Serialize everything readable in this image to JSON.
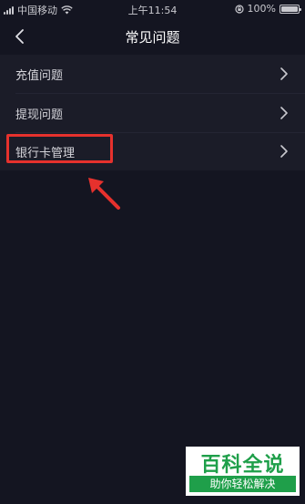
{
  "status_bar": {
    "carrier": "中国移动",
    "time": "上午11:54",
    "battery_percent": "100%",
    "battery_level": 1.0
  },
  "nav": {
    "title": "常见问题"
  },
  "faq_items": [
    {
      "label": "充值问题"
    },
    {
      "label": "提现问题"
    },
    {
      "label": "银行卡管理"
    }
  ],
  "colors": {
    "background": "#141521",
    "list_background": "#1b1c28",
    "highlight": "#e6312d",
    "watermark_green": "#1f9f4a"
  },
  "watermark": {
    "title": "百科全说",
    "subtitle": "助你轻松解决"
  }
}
